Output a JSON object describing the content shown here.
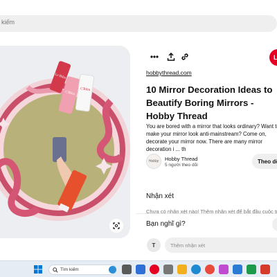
{
  "search": {
    "text": "kiếm"
  },
  "pin": {
    "source": "hobbythread.com",
    "title": "10 Mirror Decoration Ideas to Beautify Boring Mirrors - Hobby Thread",
    "description": "You are bored with a mirror that looks ordinary? Want to make your mirror look anti-mainstream? Come on, decorate your mirror now. There are many mirror decoration i ... th",
    "save_label": "L"
  },
  "creator": {
    "name": "Hobby Thread",
    "followers": "5 người theo dõi",
    "follow_label": "Theo dõ",
    "avatar_text": "Hobby"
  },
  "comments": {
    "heading": "Nhận xét",
    "empty": "Chưa có nhận xét nào! Thêm nhận xét để bắt đầu cuộc trò",
    "prompt": "Bạn nghĩ gì?",
    "input_placeholder": "Thêm nhận xét",
    "user_initial": "T"
  },
  "taskbar": {
    "search_text": "Tìm kiếm"
  },
  "colors": {
    "accent": "#e60023",
    "taskbar": "#e6ecf3"
  }
}
